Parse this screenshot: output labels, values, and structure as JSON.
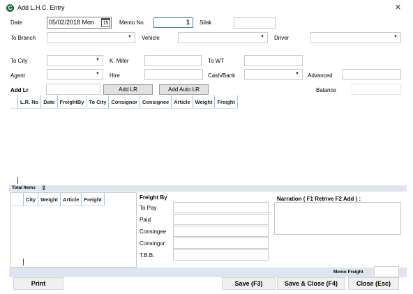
{
  "window": {
    "title": "Add L.H.C. Entry",
    "close_glyph": "×"
  },
  "form": {
    "date_label": "Date",
    "date_value": "05/02/2018 Mon",
    "calendar_day": "15",
    "memo_label": "Memo No.",
    "memo_value": "1",
    "silak_label": "Silak",
    "silak_value": "",
    "to_branch_label": "To Branch",
    "to_branch_value": "",
    "vehicle_label": "Vehicle",
    "vehicle_value": "",
    "driver_label": "Driver",
    "driver_value": "",
    "to_city_label": "To City",
    "to_city_value": "",
    "k_miter_label": "K. Miter",
    "k_miter_value": "",
    "to_wt_label": "To WT",
    "to_wt_value": "",
    "agent_label": "Agent",
    "agent_value": "",
    "hire_label": "Hire",
    "hire_value": "",
    "cash_bank_label": "Cash/Bank",
    "cash_bank_value": "",
    "advanced_label": "Advanced",
    "advanced_value": "",
    "add_lr_label": "Add Lr",
    "add_lr_value": "",
    "add_lr_button": "Add LR",
    "add_auto_lr_button": "Add Auto LR",
    "balance_label": "Balance",
    "balance_value": ""
  },
  "lr_grid": {
    "columns": [
      "L.R. No",
      "Date",
      "FreightBy",
      "To City",
      "Consignor",
      "Consignee",
      "Article",
      "Weight",
      "Freight"
    ],
    "rows": []
  },
  "totals": {
    "label": "Total Items",
    "count": "0"
  },
  "city_grid": {
    "columns": [
      "City",
      "Weight",
      "Article",
      "Freight"
    ],
    "rows": []
  },
  "freight_by": {
    "title": "Freight By",
    "to_pay_label": "To Pay",
    "paid_label": "Paid",
    "consignee_label": "Consingee",
    "consignor_label": "Consingor",
    "tbb_label": "T.B.B.",
    "to_pay_value": "",
    "paid_value": "",
    "consignee_value": "",
    "consignor_value": "",
    "tbb_value": ""
  },
  "narration": {
    "label": "Narration ( F1 Retrive F2 Add ) :",
    "value": ""
  },
  "memo_freight": {
    "label": "Memo Freight",
    "value": ""
  },
  "buttons": {
    "print": "Print",
    "save": "Save (F3)",
    "save_close": "Save & Close (F4)",
    "close": "Close (Esc)"
  },
  "colors": {
    "accent": "#1a6e3a",
    "grid_line": "#9dc3e6",
    "bar": "#dde6f0"
  },
  "icons": {
    "app": "app-logo-icon",
    "close": "close-icon",
    "calendar": "calendar-icon",
    "dropdown": "chevron-down-icon"
  }
}
